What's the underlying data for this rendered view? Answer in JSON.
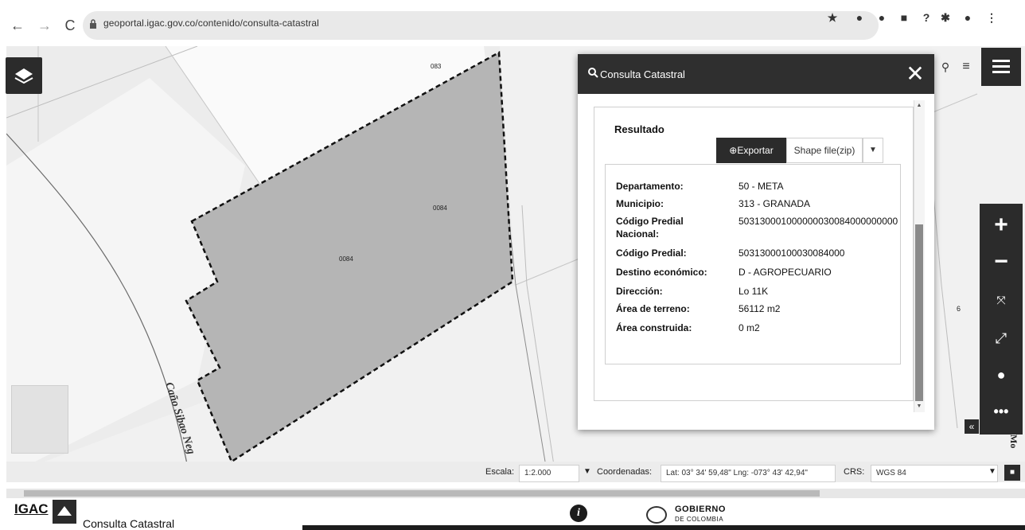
{
  "browser": {
    "url": "geoportal.igac.gov.co/contenido/consulta-catastral"
  },
  "map": {
    "labels": {
      "parcel_north": "083",
      "parcel_right": "0084",
      "parcel_center": "0084",
      "river": "Caño Sibao Neg",
      "right_edge_digit": "6",
      "right_edge_text": "Mo"
    }
  },
  "panel": {
    "title": "Consulta Catastral",
    "result_heading": "Resultado",
    "export_label": "Exportar",
    "format_selected": "Shape file(zip)",
    "rows": [
      {
        "key": "Departamento:",
        "value": "50 - META"
      },
      {
        "key": "Municipio:",
        "value": "313 - GRANADA"
      },
      {
        "key": "Código Predial Nacional:",
        "value": "503130001000000030084000000000"
      },
      {
        "key": "Código Predial:",
        "value": "50313000100030084000"
      },
      {
        "key": "Destino económico:",
        "value": "D - AGROPECUARIO"
      },
      {
        "key": "Dirección:",
        "value": "Lo 11K"
      },
      {
        "key": "Área de terreno:",
        "value": "56112 m2"
      },
      {
        "key": "Área construida:",
        "value": "0 m2"
      }
    ]
  },
  "status_bar": {
    "scale_label": "Escala:",
    "scale_value": "1:2.000",
    "coords_label": "Coordenadas:",
    "coords_value": "Lat: 03° 34' 59,48\" Lng: -073° 43' 42,94\"",
    "crs_label": "CRS:",
    "crs_value": "WGS 84"
  },
  "footer": {
    "logo_text": "IGAC",
    "title": "Consulta Catastral",
    "gob_text": "GOBIERNO",
    "gob_sub": "DE COLOMBIA"
  },
  "icons": {
    "back": "arrow-left-icon",
    "forward": "arrow-right-icon",
    "reload": "reload-icon",
    "lock": "lock-icon",
    "star": "star-icon",
    "layers": "layers-icon",
    "menu": "hamburger-icon",
    "search": "search-icon",
    "list": "list-icon",
    "zoom_in": "plus-icon",
    "zoom_out": "minus-icon",
    "extent": "fit-extent-icon",
    "fullscreen": "fullscreen-icon",
    "locate": "location-pin-icon",
    "more": "more-icon",
    "info": "info-icon"
  },
  "colors": {
    "toolbar_dark": "#2b2b2b",
    "parcel_fill": "#b5b5b5",
    "map_bg": "#f1f1f1"
  }
}
